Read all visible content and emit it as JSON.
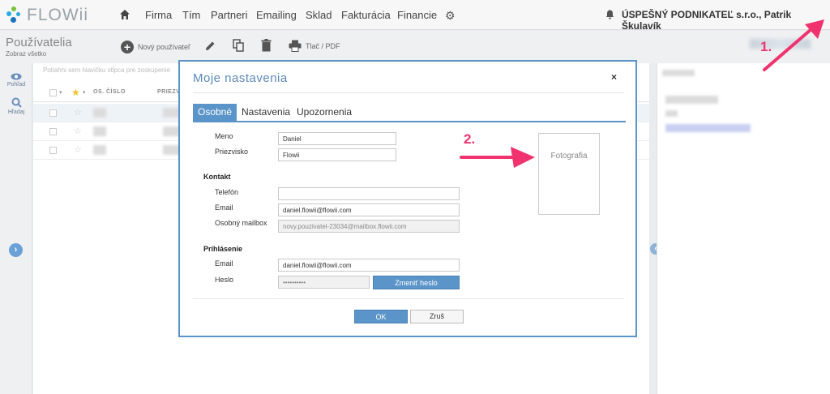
{
  "brand": {
    "name": "FLOWii"
  },
  "nav": {
    "items": [
      "Firma",
      "Tím",
      "Partneri",
      "Emailing",
      "Sklad",
      "Fakturácia",
      "Financie"
    ],
    "company": "ÚSPEŠNÝ PODNIKATEĽ s.r.o., Patrik Škulavík"
  },
  "toolbar": {
    "title": "Používatelia",
    "subtitle": "Zobraz všetko",
    "new_user": "Nový používateľ",
    "print": "Tlač / PDF"
  },
  "leftbar": {
    "view": "Pohľad",
    "search": "Hľadaj"
  },
  "list": {
    "group_hint": "Potiahni sem hlavičku stĺpca pre zoskupenie",
    "col_number": "OS. ČÍSLO",
    "col_surname": "PRIEZV"
  },
  "modal": {
    "title": "Moje nastavenia",
    "close": "×",
    "tabs": [
      "Osobné",
      "Nastavenia",
      "Upozornenia"
    ],
    "fields": {
      "meno_label": "Meno",
      "meno_value": "Daniel",
      "priezvisko_label": "Priezvisko",
      "priezvisko_value": "Flowii",
      "section_contact": "Kontakt",
      "telefon_label": "Telefón",
      "telefon_value": "",
      "email_label": "Email",
      "email_value": "daniel.flowii@flowii.com",
      "mailbox_label": "Osobný mailbox",
      "mailbox_value": "novy.pouzivatel-23034@mailbox.flowii.com",
      "section_login": "Prihlásenie",
      "login_email_label": "Email",
      "login_email_value": "daniel.flowii@flowii.com",
      "heslo_label": "Heslo",
      "heslo_value": "••••••••••",
      "change_password": "Zmeniť heslo"
    },
    "photo_label": "Fotografia",
    "ok": "OK",
    "cancel": "Zruš"
  },
  "annotations": {
    "step1": "1.",
    "step2": "2."
  },
  "colors": {
    "accent": "#5b94c8",
    "annotation": "#f0336e"
  }
}
